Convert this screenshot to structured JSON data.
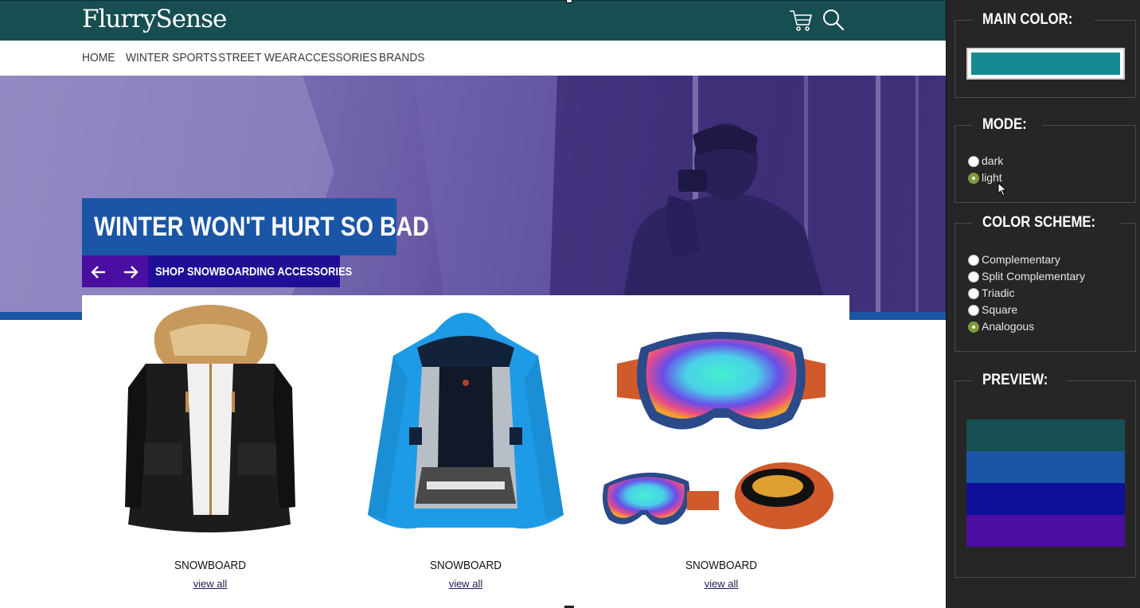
{
  "site": {
    "logo": "FlurrySense",
    "icons": {
      "cart": "cart-icon",
      "search": "search-icon"
    },
    "nav": [
      "HOME",
      "WINTER SPORTS",
      "STREET WEAR",
      "ACCESSORIES",
      "BRANDS"
    ],
    "hero": {
      "headline": "WINTER WON'T HURT SO BAD",
      "cta": "SHOP SNOWBOARDING ACCESSORIES",
      "prev_icon": "arrow-left-icon",
      "next_icon": "arrow-right-icon"
    },
    "products": [
      {
        "name": "SNOWBOARD",
        "link": "view all"
      },
      {
        "name": "SNOWBOARD",
        "link": "view all"
      },
      {
        "name": "SNOWBOARD",
        "link": "view all"
      }
    ]
  },
  "panel": {
    "main_color": {
      "title": "MAIN COLOR:",
      "value": "#168a93"
    },
    "mode": {
      "title": "MODE:",
      "options": [
        "dark",
        "light"
      ],
      "selected": "light"
    },
    "color_scheme": {
      "title": "COLOR SCHEME:",
      "options": [
        "Complementary",
        "Split Complementary",
        "Triadic",
        "Square",
        "Analogous"
      ],
      "selected": "Analogous"
    },
    "preview": {
      "title": "PREVIEW:",
      "colors": [
        "#164e52",
        "#1a55a6",
        "#0f0f9a",
        "#4a0fa0"
      ]
    }
  },
  "colors": {
    "topbar": "#164e52",
    "accent_blue": "#1a55a6",
    "accent_purple": "#4a0fa0",
    "cta_bg": "#1f0f96",
    "panel_bg": "#262626"
  }
}
